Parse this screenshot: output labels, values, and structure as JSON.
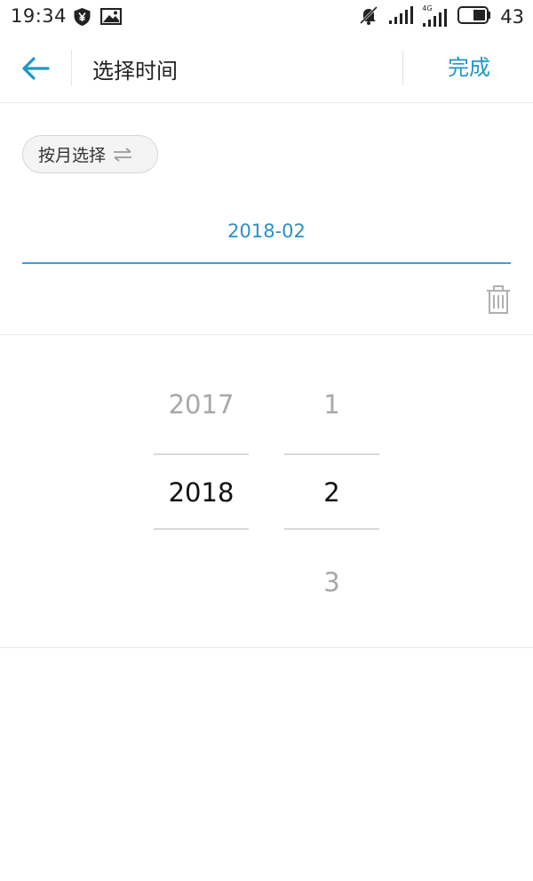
{
  "status_bar": {
    "time": "19:34",
    "battery": "43",
    "network_label": "4G",
    "icons": [
      "shield-yen-icon",
      "photo-icon",
      "mute-icon",
      "signal-icon",
      "signal-4g-icon",
      "battery-icon"
    ]
  },
  "header": {
    "title": "选择时间",
    "done_label": "完成",
    "back_icon": "arrow-left-icon"
  },
  "mode_chip": {
    "label": "按月选择",
    "icon": "swap-icon"
  },
  "date_input": {
    "value": "2018-02"
  },
  "picker": {
    "year": {
      "prev": "2017",
      "selected": "2018",
      "next": ""
    },
    "month": {
      "prev": "1",
      "selected": "2",
      "next": "3"
    }
  },
  "colors": {
    "accent": "#2196c9",
    "underline": "#3d9fd6",
    "faded_text": "#a8a8a8",
    "selected_text": "#111111",
    "divider": "#e8e8e8"
  }
}
